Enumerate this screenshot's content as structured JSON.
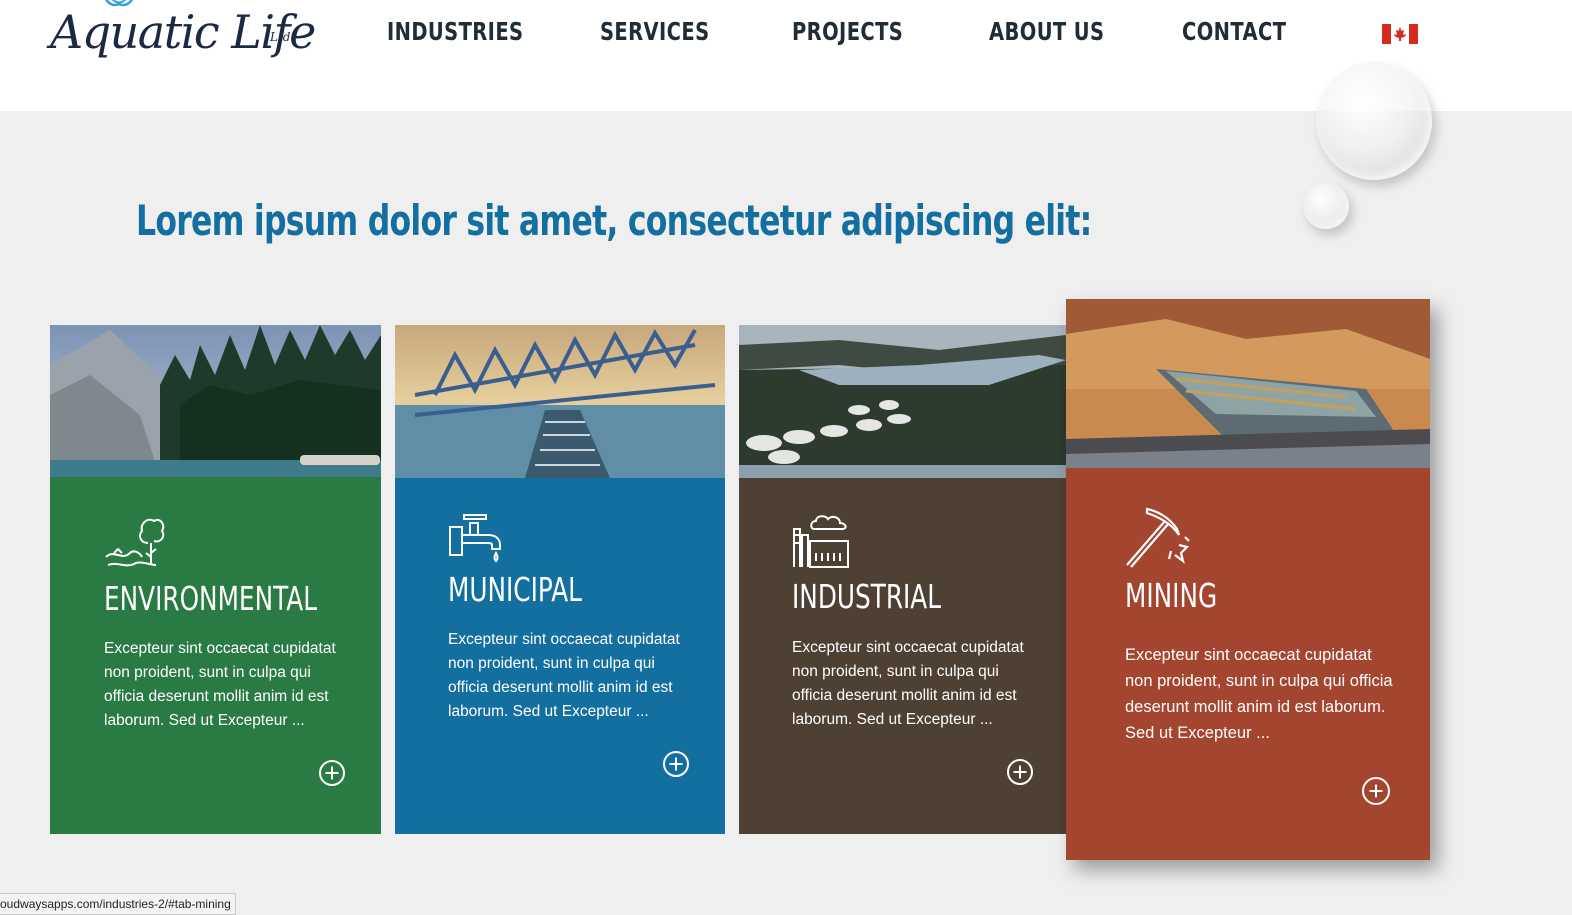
{
  "brand": {
    "name": "Aquatic Life",
    "suffix": "Ltd."
  },
  "nav": {
    "items": [
      {
        "label": "INDUSTRIES"
      },
      {
        "label": "SERVICES"
      },
      {
        "label": "PROJECTS"
      },
      {
        "label": "ABOUT US"
      },
      {
        "label": "CONTACT"
      }
    ],
    "language_flag": "canada-flag-icon"
  },
  "main": {
    "heading": "Lorem ipsum dolor sit amet, consectetur adipiscing elit:",
    "cards": [
      {
        "title": "ENVIRONMENTAL",
        "icon": "environment-tree-icon",
        "color": "#2a7a43",
        "description": "Excepteur sint occaecat cupidatat non proident, sunt in culpa qui officia deserunt mollit anim id est laborum. Sed ut Excepteur ..."
      },
      {
        "title": "MUNICIPAL",
        "icon": "faucet-icon",
        "color": "#136f9f",
        "description": "Excepteur sint occaecat cupidatat non proident, sunt in culpa qui officia deserunt mollit anim id est laborum. Sed ut Excepteur ..."
      },
      {
        "title": "INDUSTRIAL",
        "icon": "factory-icon",
        "color": "#4e4133",
        "description": "Excepteur sint occaecat cupidatat non proident, sunt in culpa qui officia deserunt mollit anim id est laborum. Sed ut Excepteur ..."
      },
      {
        "title": "MINING",
        "icon": "pickaxe-icon",
        "color": "#a4452f",
        "description": "Excepteur sint occaecat cupidatat non proident, sunt in culpa qui officia deserunt mollit anim id est laborum. Sed ut Excepteur ..."
      }
    ]
  },
  "status_bar": {
    "url": "oudwaysapps.com/industries-2/#tab-mining"
  }
}
